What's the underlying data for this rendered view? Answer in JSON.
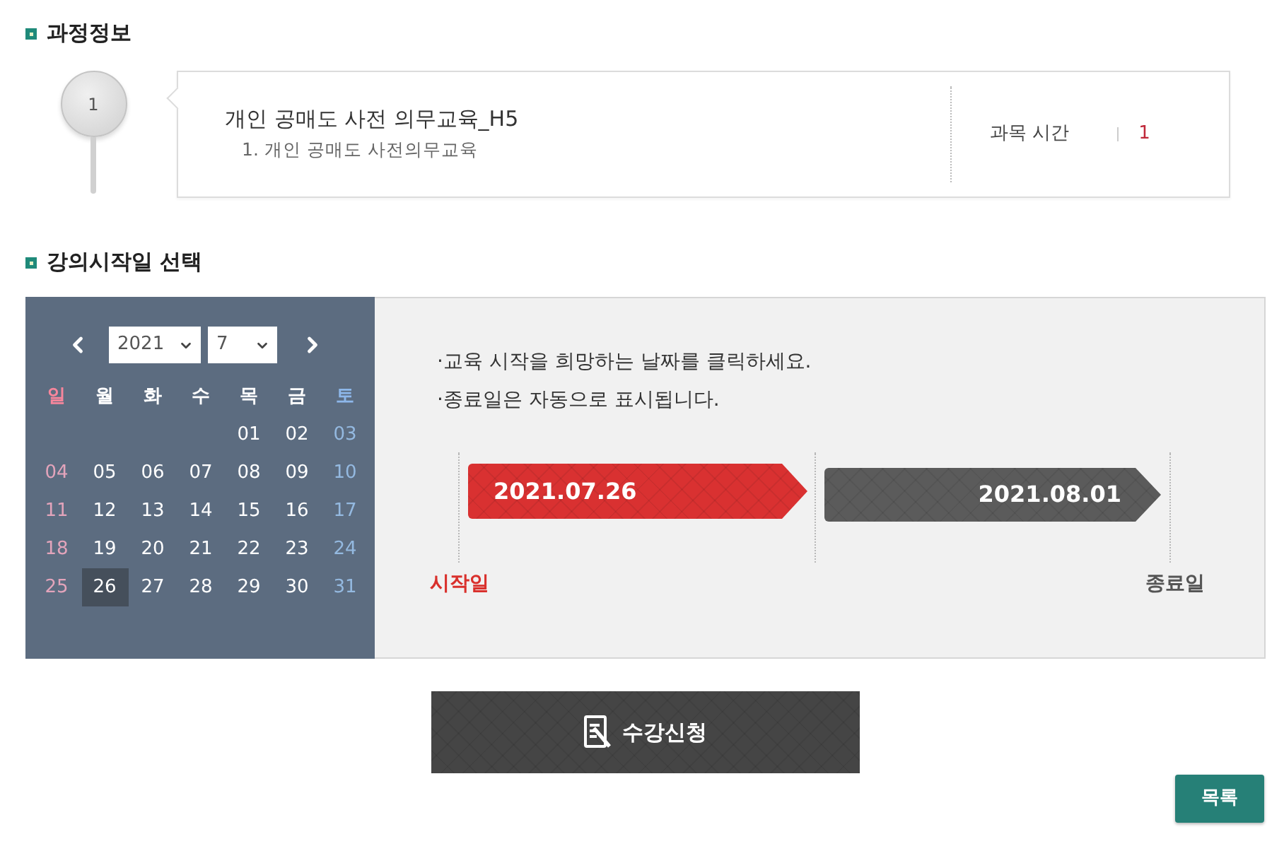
{
  "course_info": {
    "title": "과정정보",
    "step": "1",
    "course_name": "개인 공매도 사전 의무교육_H5",
    "lesson": "1. 개인 공매도 사전의무교육",
    "hours_label": "과목 시간",
    "hours_value": "1"
  },
  "start_date": {
    "title": "강의시작일 선택",
    "calendar": {
      "year": "2021",
      "month": "7",
      "weekdays": [
        {
          "label": "일",
          "kind": "sunday"
        },
        {
          "label": "월",
          "kind": "weekday"
        },
        {
          "label": "화",
          "kind": "weekday"
        },
        {
          "label": "수",
          "kind": "weekday"
        },
        {
          "label": "목",
          "kind": "weekday"
        },
        {
          "label": "금",
          "kind": "weekday"
        },
        {
          "label": "토",
          "kind": "saturday"
        }
      ],
      "weeks": [
        [
          {
            "label": "01",
            "selected": false
          },
          {
            "label": "02",
            "selected": false
          },
          {
            "label": "03",
            "selected": false
          }
        ],
        [
          {
            "label": "04",
            "selected": false
          },
          {
            "label": "05",
            "selected": false
          },
          {
            "label": "06",
            "selected": false
          },
          {
            "label": "07",
            "selected": false
          },
          {
            "label": "08",
            "selected": false
          },
          {
            "label": "09",
            "selected": false
          },
          {
            "label": "10",
            "selected": false
          }
        ],
        [
          {
            "label": "11",
            "selected": false
          },
          {
            "label": "12",
            "selected": false
          },
          {
            "label": "13",
            "selected": false
          },
          {
            "label": "14",
            "selected": false
          },
          {
            "label": "15",
            "selected": false
          },
          {
            "label": "16",
            "selected": false
          },
          {
            "label": "17",
            "selected": false
          }
        ],
        [
          {
            "label": "18",
            "selected": false
          },
          {
            "label": "19",
            "selected": false
          },
          {
            "label": "20",
            "selected": false
          },
          {
            "label": "21",
            "selected": false
          },
          {
            "label": "22",
            "selected": false
          },
          {
            "label": "23",
            "selected": false
          },
          {
            "label": "24",
            "selected": false
          }
        ],
        [
          {
            "label": "25",
            "selected": false
          },
          {
            "label": "26",
            "selected": true
          },
          {
            "label": "27",
            "selected": false
          },
          {
            "label": "28",
            "selected": false
          },
          {
            "label": "29",
            "selected": false
          },
          {
            "label": "30",
            "selected": false
          },
          {
            "label": "31",
            "selected": false
          }
        ]
      ]
    },
    "notes": [
      "·교육 시작을 희망하는 날짜를 클릭하세요.",
      "·종료일은 자동으로 표시됩니다."
    ],
    "period": {
      "start_date": "2021.07.26",
      "end_date": "2021.08.01",
      "start_label": "시작일",
      "end_label": "종료일"
    }
  },
  "actions": {
    "apply_button": "수강신청",
    "list_button": "목록"
  }
}
